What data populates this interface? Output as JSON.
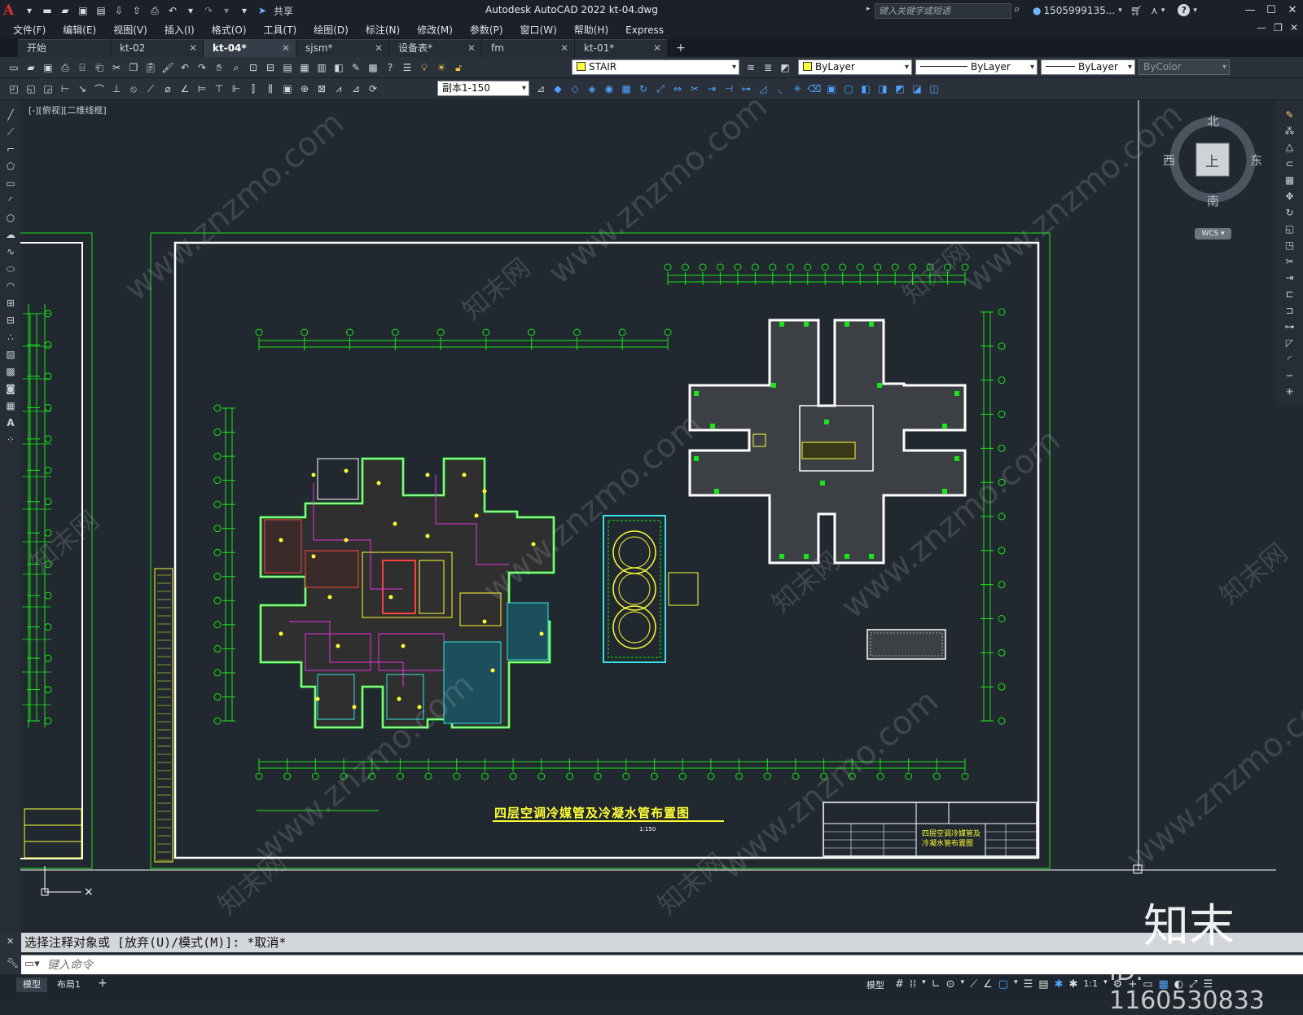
{
  "app": {
    "title": "Autodesk AutoCAD 2022    kt-04.dwg",
    "share_label": "共享",
    "search_placeholder": "键入关键字或短语",
    "user": "1505999135...",
    "cart_icon": "cart-icon",
    "help": "?"
  },
  "menu": [
    "文件(F)",
    "编辑(E)",
    "视图(V)",
    "插入(I)",
    "格式(O)",
    "工具(T)",
    "绘图(D)",
    "标注(N)",
    "修改(M)",
    "参数(P)",
    "窗口(W)",
    "帮助(H)",
    "Express"
  ],
  "tabs": [
    {
      "label": "开始",
      "closable": false,
      "active": false
    },
    {
      "label": "kt-02",
      "closable": true,
      "active": false
    },
    {
      "label": "kt-04*",
      "closable": true,
      "active": true
    },
    {
      "label": "sjsm*",
      "closable": true,
      "active": false
    },
    {
      "label": "设备表*",
      "closable": true,
      "active": false
    },
    {
      "label": "fm",
      "closable": true,
      "active": false
    },
    {
      "label": "kt-01*",
      "closable": true,
      "active": false
    }
  ],
  "toolbar": {
    "layer_name": "STAIR",
    "color": "ByLayer",
    "linetype": "ByLayer",
    "lineweight": "ByLayer",
    "plotstyle": "ByColor",
    "scale": "副本1-150"
  },
  "viewport_label": "[-][俯视][二维线框]",
  "viewcube": {
    "north": "北",
    "south": "南",
    "east": "东",
    "west": "西",
    "face": "上",
    "wcs": "WCS"
  },
  "drawing": {
    "title": "四层空调冷媒管及冷凝水管布置图",
    "scale_note": "1:150",
    "titleblock_title_1": "四层空调冷媒管及",
    "titleblock_title_2": "冷凝水管布置图"
  },
  "command": {
    "history": "选择注释对象或 [放弃(U)/模式(M)]: *取消*",
    "input_placeholder": "键入命令"
  },
  "status": {
    "tab_model": "模型",
    "tab_layout": "布局1",
    "model_btn": "模型",
    "scale": "1:1"
  },
  "watermark": {
    "site": "www.znzmo.com",
    "brand": "知末网",
    "logo": "知末",
    "id": "ID: 1160530833"
  },
  "colors": {
    "canvas": "#212830",
    "cad_green": "#19e619",
    "cad_white": "#ffffff",
    "cad_yellow": "#ffff33",
    "cad_cyan": "#33e6e6",
    "cad_magenta": "#e633e6",
    "cad_red": "#ff4040"
  }
}
